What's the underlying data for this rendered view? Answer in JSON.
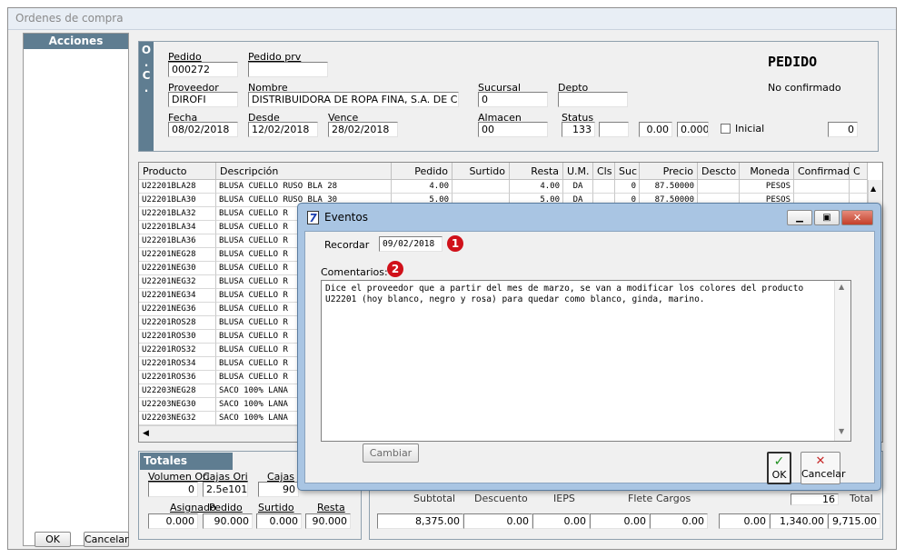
{
  "window": {
    "title": "Ordenes de compra"
  },
  "left_panel": {
    "actions_title": "Acciones",
    "ok_label": "OK",
    "cancel_label": "Cancelar"
  },
  "oc_badge": [
    "O",
    ".",
    "C",
    "."
  ],
  "header": {
    "pedido_label": "Pedido",
    "pedido_value": "000272",
    "pedido_prv_label": "Pedido prv",
    "pedido_prv_value": "",
    "title": "PEDIDO",
    "status_text": "No confirmado",
    "proveedor_label": "Proveedor",
    "proveedor_value": "DIROFI",
    "nombre_label": "Nombre",
    "nombre_value": "DISTRIBUIDORA DE ROPA FINA, S.A. DE C.V",
    "sucursal_label": "Sucursal",
    "sucursal_value": "0",
    "depto_label": "Depto",
    "depto_value": "",
    "fecha_label": "Fecha",
    "fecha_value": "08/02/2018",
    "desde_label": "Desde",
    "desde_value": "12/02/2018",
    "vence_label": "Vence",
    "vence_value": "28/02/2018",
    "almacen_label": "Almacen",
    "almacen_value": "00",
    "status_label": "Status",
    "status_value": "133",
    "blank_field": "",
    "val1": "0.00",
    "val2": "0.000",
    "inicial_label": "Inicial",
    "right_value": "0"
  },
  "grid": {
    "columns": [
      "Producto",
      "Descripción",
      "Pedido",
      "Surtido",
      "Resta",
      "U.M.",
      "Cls",
      "Suc",
      "Precio",
      "Descto",
      "Moneda",
      "Confirmado",
      "C"
    ],
    "rows": [
      {
        "producto": "U22201BLA28",
        "descripcion": "BLUSA CUELLO RUSO BLA 28",
        "pedido": "4.00",
        "surtido": "",
        "resta": "4.00",
        "um": "DA",
        "cls": "",
        "suc": "0",
        "precio": "87.50000",
        "descto": "",
        "moneda": "PESOS"
      },
      {
        "producto": "U22201BLA30",
        "descripcion": "BLUSA CUELLO RUSO BLA 30",
        "pedido": "5.00",
        "surtido": "",
        "resta": "5.00",
        "um": "DA",
        "cls": "",
        "suc": "0",
        "precio": "87.50000",
        "descto": "",
        "moneda": "PESOS"
      },
      {
        "producto": "U22201BLA32",
        "descripcion": "BLUSA CUELLO R",
        "pedido": "",
        "surtido": "",
        "resta": "",
        "um": "",
        "cls": "",
        "suc": "",
        "precio": "",
        "descto": "",
        "moneda": ""
      },
      {
        "producto": "U22201BLA34",
        "descripcion": "BLUSA CUELLO R",
        "pedido": "",
        "surtido": "",
        "resta": "",
        "um": "",
        "cls": "",
        "suc": "",
        "precio": "",
        "descto": "",
        "moneda": ""
      },
      {
        "producto": "U22201BLA36",
        "descripcion": "BLUSA CUELLO R",
        "pedido": "",
        "surtido": "",
        "resta": "",
        "um": "",
        "cls": "",
        "suc": "",
        "precio": "",
        "descto": "",
        "moneda": ""
      },
      {
        "producto": "U22201NEG28",
        "descripcion": "BLUSA CUELLO R",
        "pedido": "",
        "surtido": "",
        "resta": "",
        "um": "",
        "cls": "",
        "suc": "",
        "precio": "",
        "descto": "",
        "moneda": ""
      },
      {
        "producto": "U22201NEG30",
        "descripcion": "BLUSA CUELLO R",
        "pedido": "",
        "surtido": "",
        "resta": "",
        "um": "",
        "cls": "",
        "suc": "",
        "precio": "",
        "descto": "",
        "moneda": ""
      },
      {
        "producto": "U22201NEG32",
        "descripcion": "BLUSA CUELLO R",
        "pedido": "",
        "surtido": "",
        "resta": "",
        "um": "",
        "cls": "",
        "suc": "",
        "precio": "",
        "descto": "",
        "moneda": ""
      },
      {
        "producto": "U22201NEG34",
        "descripcion": "BLUSA CUELLO R",
        "pedido": "",
        "surtido": "",
        "resta": "",
        "um": "",
        "cls": "",
        "suc": "",
        "precio": "",
        "descto": "",
        "moneda": ""
      },
      {
        "producto": "U22201NEG36",
        "descripcion": "BLUSA CUELLO R",
        "pedido": "",
        "surtido": "",
        "resta": "",
        "um": "",
        "cls": "",
        "suc": "",
        "precio": "",
        "descto": "",
        "moneda": ""
      },
      {
        "producto": "U22201ROS28",
        "descripcion": "BLUSA CUELLO R",
        "pedido": "",
        "surtido": "",
        "resta": "",
        "um": "",
        "cls": "",
        "suc": "",
        "precio": "",
        "descto": "",
        "moneda": ""
      },
      {
        "producto": "U22201ROS30",
        "descripcion": "BLUSA CUELLO R",
        "pedido": "",
        "surtido": "",
        "resta": "",
        "um": "",
        "cls": "",
        "suc": "",
        "precio": "",
        "descto": "",
        "moneda": ""
      },
      {
        "producto": "U22201ROS32",
        "descripcion": "BLUSA CUELLO R",
        "pedido": "",
        "surtido": "",
        "resta": "",
        "um": "",
        "cls": "",
        "suc": "",
        "precio": "",
        "descto": "",
        "moneda": ""
      },
      {
        "producto": "U22201ROS34",
        "descripcion": "BLUSA CUELLO R",
        "pedido": "",
        "surtido": "",
        "resta": "",
        "um": "",
        "cls": "",
        "suc": "",
        "precio": "",
        "descto": "",
        "moneda": ""
      },
      {
        "producto": "U22201ROS36",
        "descripcion": "BLUSA CUELLO R",
        "pedido": "",
        "surtido": "",
        "resta": "",
        "um": "",
        "cls": "",
        "suc": "",
        "precio": "",
        "descto": "",
        "moneda": ""
      },
      {
        "producto": "U22203NEG28",
        "descripcion": "SACO 100% LANA",
        "pedido": "",
        "surtido": "",
        "resta": "",
        "um": "",
        "cls": "",
        "suc": "",
        "precio": "",
        "descto": "",
        "moneda": ""
      },
      {
        "producto": "U22203NEG30",
        "descripcion": "SACO 100% LANA",
        "pedido": "",
        "surtido": "",
        "resta": "",
        "um": "",
        "cls": "",
        "suc": "",
        "precio": "",
        "descto": "",
        "moneda": ""
      },
      {
        "producto": "U22203NEG32",
        "descripcion": "SACO 100% LANA",
        "pedido": "",
        "surtido": "",
        "resta": "",
        "um": "",
        "cls": "",
        "suc": "",
        "precio": "",
        "descto": "",
        "moneda": ""
      }
    ]
  },
  "totals": {
    "title": "Totales",
    "volumen_ori_label": "Volumen Ori",
    "volumen_ori_value": "0",
    "cajas_ori_label": "Cajas Ori",
    "cajas_ori_value": "2.5e101",
    "cajas_label": "Cajas",
    "cajas_value": "90",
    "asignado_label": "Asignado",
    "asignado_value": "0.000",
    "pedido_label": "Pedido",
    "pedido_value": "90.000",
    "surtido_label": "Surtido",
    "surtido_value": "0.000",
    "resta_label": "Resta",
    "resta_value": "90.000"
  },
  "summary": {
    "labels": [
      "Subtotal",
      "Descuento",
      "IEPS",
      "Flete",
      "Cargos",
      "Total"
    ],
    "right_top_value": "16",
    "values": [
      "8,375.00",
      "0.00",
      "0.00",
      "0.00",
      "0.00",
      "0.00",
      "1,340.00",
      "9,715.00"
    ]
  },
  "dialog": {
    "title": "Eventos",
    "app_icon_glyph": "7",
    "recordar_label": "Recordar",
    "recordar_value": "09/02/2018",
    "badge1": "1",
    "badge2": "2",
    "comentarios_label": "Comentarios:",
    "comment_text": "Dice el proveedor que a partir del mes de marzo, se van a modificar los colores del producto U22201 (hoy blanco, negro y rosa) para quedar como blanco, ginda, marino.",
    "cambiar_label": "Cambiar",
    "ok_label": "OK",
    "cancel_label": "Cancelar",
    "ok_glyph": "✓",
    "cancel_glyph": "✕"
  },
  "colors": {
    "accent_blue": "#5f7d91",
    "badge_red": "#d0111a",
    "dialog_frame": "#a9c5e3"
  }
}
